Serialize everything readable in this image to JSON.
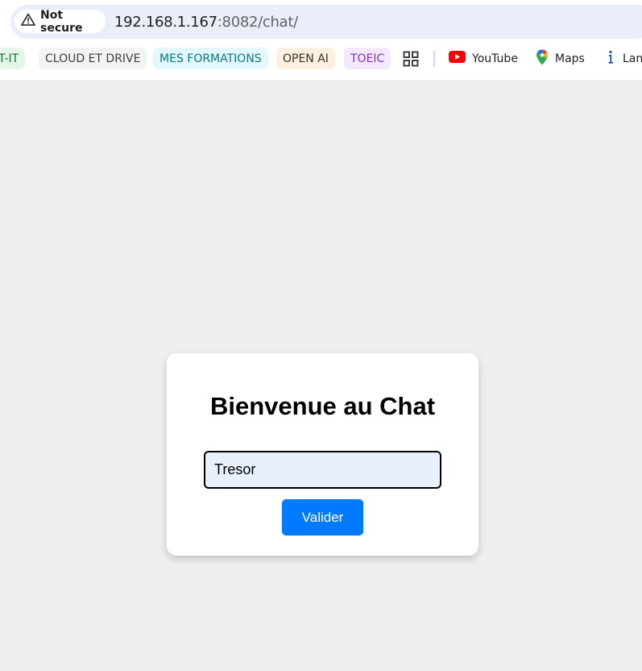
{
  "browser": {
    "security_label": "Not secure",
    "url_host": "192.168.1.167",
    "url_path": ":8082/chat/"
  },
  "bookmarks": [
    {
      "label": "IT-IT",
      "bg": "#e6f4ea",
      "color": "#137333"
    },
    {
      "label": "CLOUD ET DRIVE",
      "bg": "#f1f3f4",
      "color": "#3c4043"
    },
    {
      "label": "MES FORMATIONS",
      "bg": "#e4f7fb",
      "color": "#007b83"
    },
    {
      "label": "OPEN AI",
      "bg": "#feefe3",
      "color": "#3c2f1e"
    },
    {
      "label": "TOEIC",
      "bg": "#f3e8fd",
      "color": "#8430ce"
    },
    {
      "label": "YouTube",
      "icon": "youtube-icon"
    },
    {
      "label": "Maps",
      "icon": "maps-icon"
    },
    {
      "label": "Lan",
      "icon": "info-icon"
    }
  ],
  "chat_login": {
    "title": "Bienvenue au Chat",
    "name_value": "Tresor",
    "submit_label": "Valider"
  },
  "colors": {
    "accent": "#007bff",
    "input_bg": "#e8f0fe",
    "page_bg": "#efefef"
  }
}
